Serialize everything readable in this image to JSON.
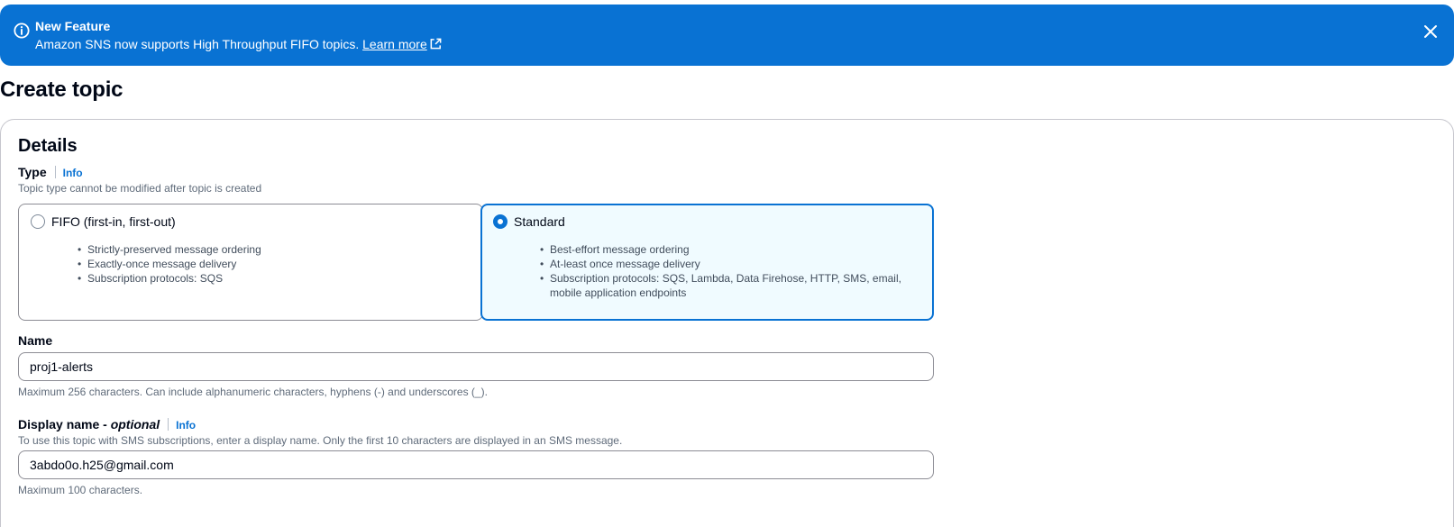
{
  "flash": {
    "title": "New Feature",
    "message": "Amazon SNS now supports High Throughput FIFO topics.",
    "link_label": "Learn more"
  },
  "page": {
    "title": "Create topic"
  },
  "details": {
    "section_title": "Details",
    "type": {
      "label": "Type",
      "info_label": "Info",
      "description": "Topic type cannot be modified after topic is created",
      "options": [
        {
          "label": "FIFO (first-in, first-out)",
          "selected": false,
          "bullets": [
            "Strictly-preserved message ordering",
            "Exactly-once message delivery",
            "Subscription protocols: SQS"
          ]
        },
        {
          "label": "Standard",
          "selected": true,
          "bullets": [
            "Best-effort message ordering",
            "At-least once message delivery",
            "Subscription protocols: SQS, Lambda, Data Firehose, HTTP, SMS, email, mobile application endpoints"
          ]
        }
      ]
    },
    "name": {
      "label": "Name",
      "value": "proj1-alerts",
      "hint": "Maximum 256 characters. Can include alphanumeric characters, hyphens (-) and underscores (_)."
    },
    "display_name": {
      "label": "Display name - ",
      "label_optional": "optional",
      "info_label": "Info",
      "description": "To use this topic with SMS subscriptions, enter a display name. Only the first 10 characters are displayed in an SMS message.",
      "value": "3abdo0o.h25@gmail.com",
      "hint": "Maximum 100 characters."
    }
  },
  "colors": {
    "accent": "#0972d3",
    "selected_bg": "#f0fbff",
    "text": "#000716",
    "muted": "#5f6b7a"
  },
  "icons": {
    "flash": "info-circle-icon",
    "close": "close-icon",
    "external": "external-link-icon"
  }
}
